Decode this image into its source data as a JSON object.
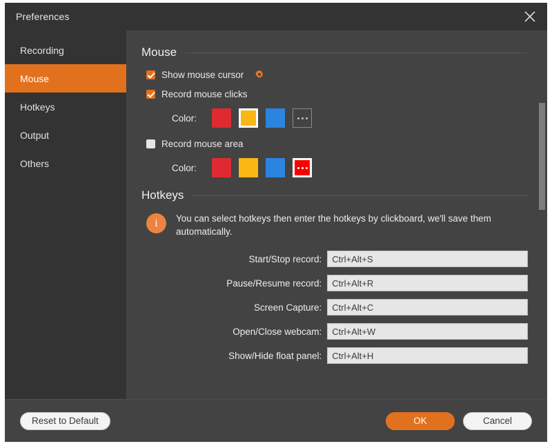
{
  "window": {
    "title": "Preferences",
    "close_icon": "close-icon",
    "accent_color": "#e2711d"
  },
  "sidebar": {
    "items": [
      {
        "label": "Recording",
        "active": false
      },
      {
        "label": "Mouse",
        "active": true
      },
      {
        "label": "Hotkeys",
        "active": false
      },
      {
        "label": "Output",
        "active": false
      },
      {
        "label": "Others",
        "active": false
      }
    ]
  },
  "mouse_section": {
    "heading": "Mouse",
    "show_cursor": {
      "label": "Show mouse cursor",
      "checked": true,
      "settings_icon": "gear-icon"
    },
    "record_clicks": {
      "label": "Record mouse clicks",
      "checked": true
    },
    "clicks_color": {
      "label": "Color:",
      "swatches": [
        {
          "color": "#e02a32",
          "selected": false,
          "more": false
        },
        {
          "color": "#fbb713",
          "selected": true,
          "more": false
        },
        {
          "color": "#2b84e0",
          "selected": false,
          "more": false
        },
        {
          "color": "",
          "selected": false,
          "more": true
        }
      ]
    },
    "record_area": {
      "label": "Record mouse area",
      "checked": false
    },
    "area_color": {
      "label": "Color:",
      "swatches": [
        {
          "color": "#e02a32",
          "selected": false,
          "more": false
        },
        {
          "color": "#fbb713",
          "selected": false,
          "more": false
        },
        {
          "color": "#2b84e0",
          "selected": false,
          "more": false
        },
        {
          "color": "#fb0000",
          "selected": true,
          "more": true
        }
      ]
    }
  },
  "hotkeys_section": {
    "heading": "Hotkeys",
    "info_icon": "info-icon",
    "info_text": "You can select hotkeys then enter the hotkeys by clickboard, we'll save them automatically.",
    "rows": [
      {
        "label": "Start/Stop record:",
        "value": "Ctrl+Alt+S"
      },
      {
        "label": "Pause/Resume record:",
        "value": "Ctrl+Alt+R"
      },
      {
        "label": "Screen Capture:",
        "value": "Ctrl+Alt+C"
      },
      {
        "label": "Open/Close webcam:",
        "value": "Ctrl+Alt+W"
      },
      {
        "label": "Show/Hide float panel:",
        "value": "Ctrl+Alt+H"
      }
    ]
  },
  "footer": {
    "reset_label": "Reset to Default",
    "ok_label": "OK",
    "cancel_label": "Cancel"
  }
}
